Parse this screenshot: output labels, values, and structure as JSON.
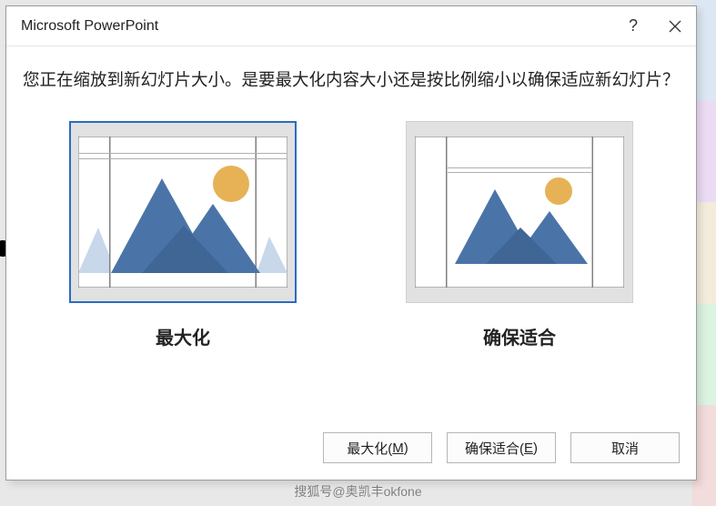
{
  "titlebar": {
    "title": "Microsoft PowerPoint",
    "help_label": "?",
    "close_label": "×"
  },
  "message": "您正在缩放到新幻灯片大小。是要最大化内容大小还是按比例缩小以确保适应新幻灯片？",
  "options": {
    "maximize": {
      "label": "最大化",
      "selected": true
    },
    "ensure_fit": {
      "label": "确保适合",
      "selected": false
    }
  },
  "buttons": {
    "maximize": {
      "text": "最大化(",
      "key": "M",
      "suffix": ")"
    },
    "ensure_fit": {
      "text": "确保适合(",
      "key": "E",
      "suffix": ")"
    },
    "cancel": "取消"
  },
  "watermark": "搜狐号@奥凯丰okfone"
}
